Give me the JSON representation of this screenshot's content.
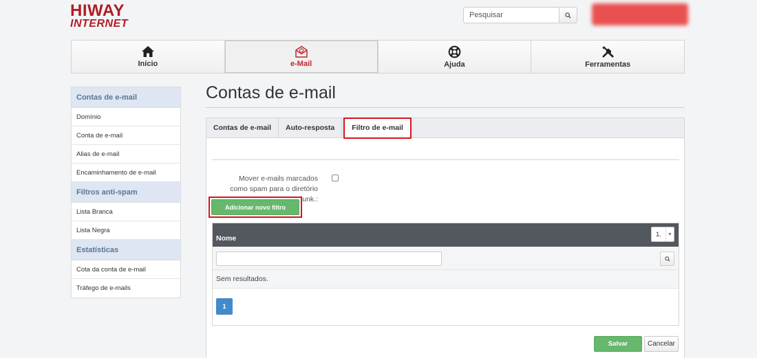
{
  "logo": {
    "line1": "HIWAY",
    "line2": "INTERNET",
    "color": "#b01e23"
  },
  "search": {
    "placeholder": "Pesquisar",
    "icon": "search-icon"
  },
  "nav": {
    "items": [
      {
        "label": "Início",
        "icon": "home-icon"
      },
      {
        "label": "e-Mail",
        "icon": "email-icon",
        "active": true
      },
      {
        "label": "Ajuda",
        "icon": "lifebuoy-icon"
      },
      {
        "label": "Ferramentas",
        "icon": "tools-icon"
      }
    ]
  },
  "sidebar": {
    "sections": [
      {
        "title": "Contas de e-mail",
        "items": [
          "Domínio",
          "Conta de e-mail",
          "Alias de e-mail",
          "Encaminhamento de e-mail"
        ]
      },
      {
        "title": "Filtros anti-spam",
        "items": [
          "Lista Branca",
          "Lista Negra"
        ]
      },
      {
        "title": "Estatísticas",
        "items": [
          "Cota da conta de e-mail",
          "Tráfego de e-mails"
        ]
      }
    ]
  },
  "main": {
    "title": "Contas de e-mail",
    "tabs": [
      {
        "label": "Contas de e-mail"
      },
      {
        "label": "Auto-resposta"
      },
      {
        "label": "Filtro de e-mail",
        "active": true
      }
    ],
    "option": {
      "label": "Mover e-mails marcados como spam para o diretório junk.:",
      "checked": false
    },
    "add_button": "Adicionar novo filtro",
    "table": {
      "column": "Nome",
      "per_page": "1.",
      "filter_value": "",
      "empty_text": "Sem resultados.",
      "page": "1"
    },
    "actions": {
      "save": "Salvar",
      "cancel": "Cancelar"
    }
  },
  "colors": {
    "accent_red": "#d6141d",
    "green_button": "#66b86c",
    "table_header": "#53575e",
    "pagination": "#428bca",
    "sidebar_header": "#dde6f2"
  }
}
